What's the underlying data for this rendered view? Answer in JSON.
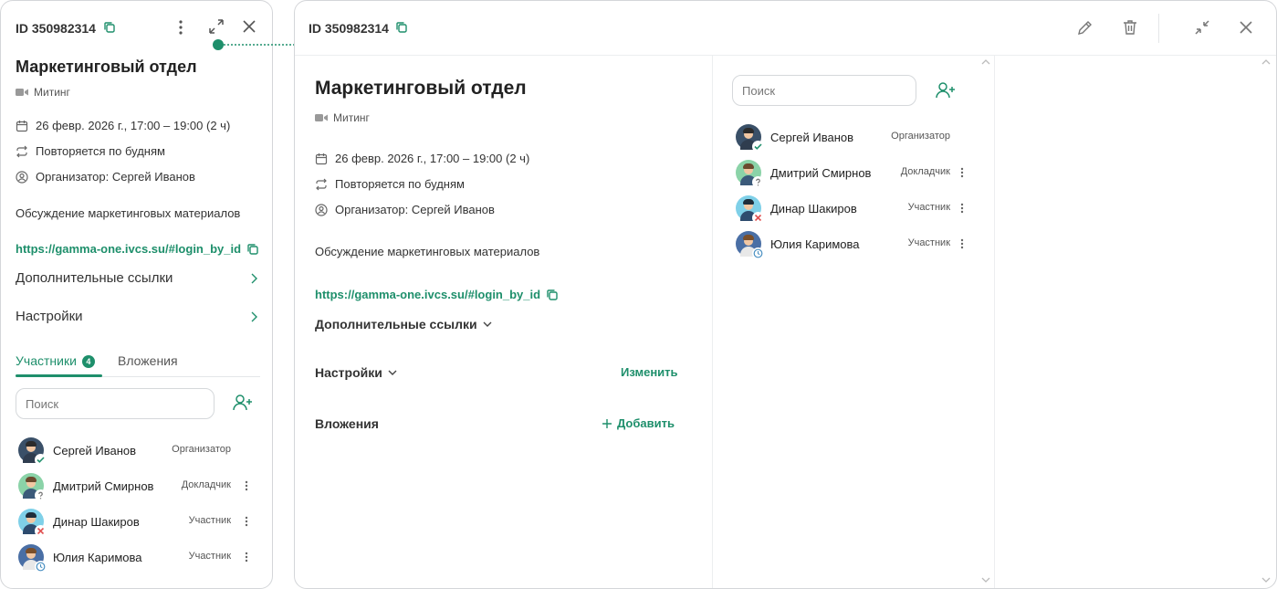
{
  "meeting": {
    "id": "ID 350982314",
    "title": "Маркетинговый отдел",
    "type": "Митинг",
    "datetime": "26 февр. 2026 г., 17:00 – 19:00 (2 ч)",
    "recurrence": "Повторяется по будням",
    "organizer": "Организатор: Сергей Иванов",
    "description": "Обсуждение маркетинговых материалов",
    "link": "https://gamma-one.ivcs.su/#login_by_id"
  },
  "compact": {
    "additional_links": "Дополнительные ссылки",
    "settings": "Настройки",
    "tabs": {
      "participants": "Участники",
      "participants_count": "4",
      "attachments": "Вложения"
    }
  },
  "expanded": {
    "additional_links": "Дополнительные ссылки",
    "settings": "Настройки",
    "settings_action": "Изменить",
    "attachments": "Вложения",
    "attachments_action": "Добавить"
  },
  "search": {
    "placeholder": "Поиск"
  },
  "participants": [
    {
      "name": "Сергей Иванов",
      "role": "Организатор",
      "status": "accepted",
      "bg": "#3a5068",
      "hair": "#2b2b2b",
      "body": "#2f3d4f",
      "has_menu": false
    },
    {
      "name": "Дмитрий Смирнов",
      "role": "Докладчик",
      "status": "unknown",
      "bg": "#8bd3a8",
      "hair": "#6b4a2e",
      "body": "#3b5a7a",
      "has_menu": true
    },
    {
      "name": "Динар Шакиров",
      "role": "Участник",
      "status": "declined",
      "bg": "#7fd0e8",
      "hair": "#1f2d3a",
      "body": "#2d4b6e",
      "has_menu": true
    },
    {
      "name": "Юлия Каримова",
      "role": "Участник",
      "status": "pending",
      "bg": "#4a6fa5",
      "hair": "#7a4f2a",
      "body": "#e8e8e8",
      "has_menu": true
    }
  ],
  "colors": {
    "accent": "#1e8f6b",
    "declined": "#e05252",
    "icon": "#666666"
  }
}
